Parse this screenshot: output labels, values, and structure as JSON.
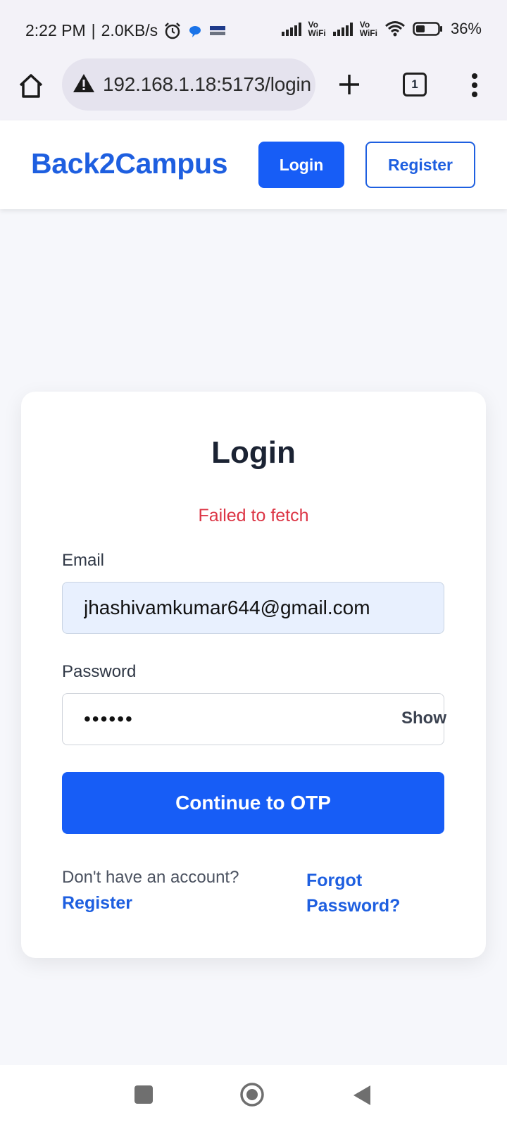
{
  "status_bar": {
    "time": "2:22 PM",
    "net_speed": "2.0KB/s",
    "vowifi_label_top": "Vo",
    "vowifi_label_bottom": "WiFi",
    "battery": "36%",
    "icons": [
      "alarm-icon",
      "chat-bubble-icon",
      "paytm-icon",
      "signal-icon",
      "wifi-icon",
      "battery-icon"
    ]
  },
  "browser": {
    "url": "192.168.1.18:5173/login",
    "tab_count": "1",
    "icons": [
      "home-icon",
      "not-secure-icon",
      "plus-icon",
      "tabs-icon",
      "more-vertical-icon"
    ]
  },
  "header": {
    "brand": "Back2Campus",
    "login_label": "Login",
    "register_label": "Register"
  },
  "login_card": {
    "title": "Login",
    "error": "Failed to fetch",
    "email_label": "Email",
    "email_value": "jhashivamkumar644@gmail.com",
    "password_label": "Password",
    "password_value": "••••••",
    "show_label": "Show",
    "submit_label": "Continue to OTP",
    "no_account_text": "Don't have an account?",
    "register_link": "Register",
    "forgot_link": "Forgot Password?"
  },
  "nav_bar": {
    "icons": [
      "recents-icon",
      "home-circle-icon",
      "back-icon"
    ]
  },
  "colors": {
    "accent": "#175df6",
    "brand_text": "#1e5fe0",
    "error": "#dc3545",
    "page_bg": "#f6f7fb"
  }
}
